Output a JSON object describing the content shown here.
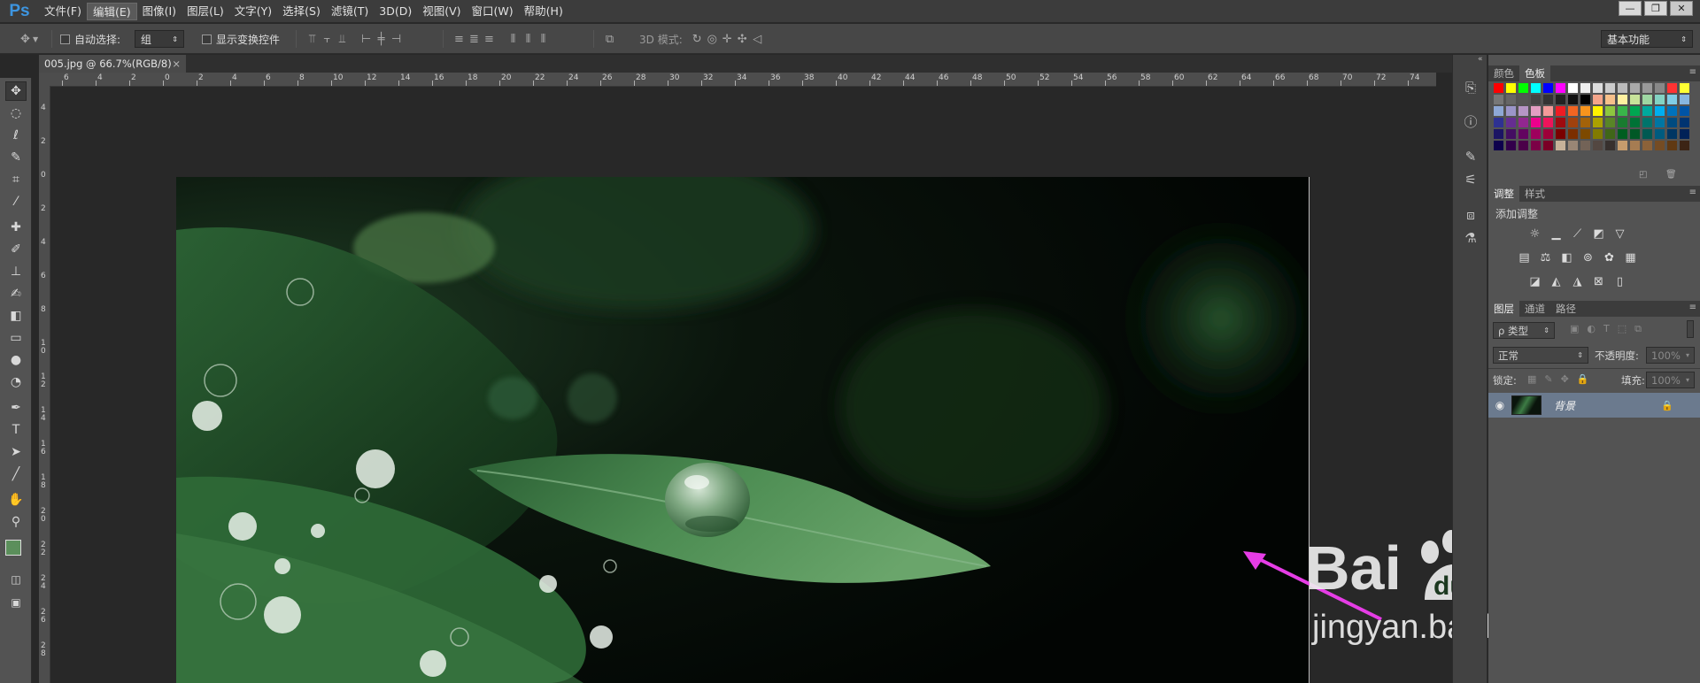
{
  "app": {
    "logo": "Ps",
    "menus": [
      "文件(F)",
      "编辑(E)",
      "图像(I)",
      "图层(L)",
      "文字(Y)",
      "选择(S)",
      "滤镜(T)",
      "3D(D)",
      "视图(V)",
      "窗口(W)",
      "帮助(H)"
    ],
    "active_menu_index": 1,
    "window_controls": [
      "—",
      "❐",
      "✕"
    ]
  },
  "options": {
    "auto_select_label": "自动选择:",
    "auto_select_value": "组",
    "show_transform_label": "显示变换控件",
    "mode_3d_label": "3D 模式:",
    "workspace": "基本功能"
  },
  "document": {
    "tab_title": "005.jpg @ 66.7%(RGB/8)",
    "tab_close": "×"
  },
  "ruler": {
    "top_labels": [
      "6",
      "4",
      "2",
      "0",
      "2",
      "4",
      "6",
      "8",
      "10",
      "12",
      "14",
      "16",
      "18",
      "20",
      "22",
      "24",
      "26",
      "28",
      "30",
      "32",
      "34",
      "36",
      "38",
      "40",
      "42",
      "44",
      "46",
      "48",
      "50",
      "52",
      "54",
      "56",
      "58",
      "60",
      "62",
      "64",
      "66",
      "68",
      "70",
      "72",
      "74"
    ],
    "left_labels": [
      "4",
      "2",
      "0",
      "2",
      "4",
      "6",
      "8",
      "1\n0",
      "1\n2",
      "1\n4",
      "1\n6",
      "1\n8",
      "2\n0",
      "2\n2",
      "2\n4",
      "2\n6",
      "2\n8"
    ]
  },
  "panels": {
    "color_tabs": [
      "颜色",
      "色板"
    ],
    "adjust_tabs": [
      "调整",
      "样式"
    ],
    "adjust_title": "添加调整",
    "layers_tabs": [
      "图层",
      "通道",
      "路径"
    ],
    "filter_kind": "ρ 类型",
    "blend_mode": "正常",
    "opacity_label": "不透明度:",
    "opacity_value": "100%",
    "lock_label": "锁定:",
    "fill_label": "填充:",
    "fill_value": "100%",
    "layer_name": "背景"
  },
  "watermark": {
    "brand_text": "Bai du 经验",
    "url": "jingyan.baidu.com"
  },
  "colors": {
    "accent": "#3d95e0",
    "arrow": "#e63de6",
    "layer_selected": "#6b7a8e"
  }
}
